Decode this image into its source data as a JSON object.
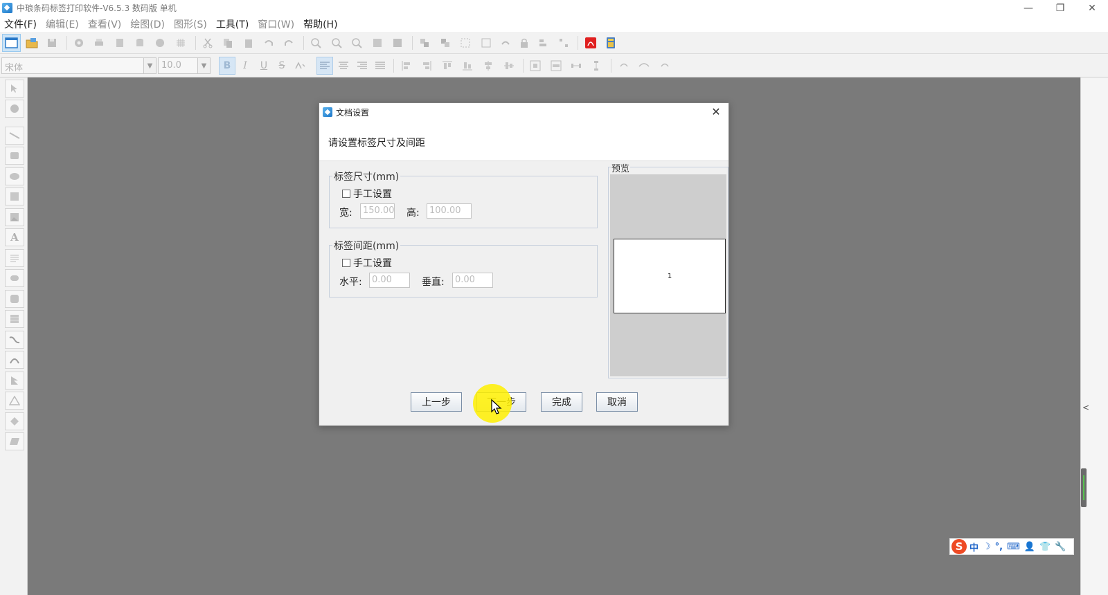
{
  "window": {
    "title": "中琅条码标签打印软件-V6.5.3 数码版 单机",
    "minimize": "—",
    "restore": "❐",
    "close": "✕"
  },
  "menu": [
    {
      "label": "文件(F)",
      "enabled": true
    },
    {
      "label": "编辑(E)",
      "enabled": false
    },
    {
      "label": "查看(V)",
      "enabled": false
    },
    {
      "label": "绘图(D)",
      "enabled": false
    },
    {
      "label": "图形(S)",
      "enabled": false
    },
    {
      "label": "工具(T)",
      "enabled": true
    },
    {
      "label": "窗口(W)",
      "enabled": false
    },
    {
      "label": "帮助(H)",
      "enabled": true
    }
  ],
  "format_toolbar": {
    "font_name": "宋体",
    "font_size": "10.0",
    "bold": "B",
    "italic": "I",
    "underline": "U",
    "strike": "S"
  },
  "left_tools": {
    "text_tool": "A"
  },
  "dialog": {
    "title": "文档设置",
    "close": "✕",
    "instruction": "请设置标签尺寸及间距",
    "size_group": {
      "legend": "标签尺寸(mm)",
      "manual_label": "手工设置",
      "manual_checked": false,
      "width_label": "宽:",
      "width_value": "150.00",
      "height_label": "高:",
      "height_value": "100.00"
    },
    "gap_group": {
      "legend": "标签间距(mm)",
      "manual_label": "手工设置",
      "manual_checked": false,
      "horizontal_label": "水平:",
      "horizontal_value": "0.00",
      "vertical_label": "垂直:",
      "vertical_value": "0.00"
    },
    "preview": {
      "legend": "预览",
      "label_number": "1"
    },
    "buttons": {
      "prev": "上一步",
      "next": "下一步",
      "finish": "完成",
      "cancel": "取消"
    }
  },
  "ime": {
    "logo": "S",
    "mode": "中",
    "moon": "☽",
    "punct": "°,",
    "keyboard": "⌨",
    "user": "👤",
    "shirt": "👕",
    "tool": "🔧"
  },
  "colors": {
    "workspace": "#7a7a7a",
    "dialog_bg": "#f0f0f0",
    "preview_bg": "#cecece",
    "cursor_highlight": "#fff000",
    "ime_logo": "#ee4a24"
  }
}
